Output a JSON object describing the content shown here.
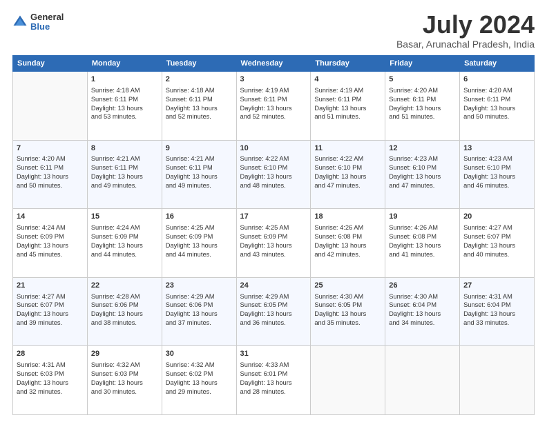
{
  "header": {
    "logo": {
      "line1": "General",
      "line2": "Blue"
    },
    "title": "July 2024",
    "subtitle": "Basar, Arunachal Pradesh, India"
  },
  "weekdays": [
    "Sunday",
    "Monday",
    "Tuesday",
    "Wednesday",
    "Thursday",
    "Friday",
    "Saturday"
  ],
  "weeks": [
    [
      {
        "day": "",
        "info": ""
      },
      {
        "day": "1",
        "info": "Sunrise: 4:18 AM\nSunset: 6:11 PM\nDaylight: 13 hours\nand 53 minutes."
      },
      {
        "day": "2",
        "info": "Sunrise: 4:18 AM\nSunset: 6:11 PM\nDaylight: 13 hours\nand 52 minutes."
      },
      {
        "day": "3",
        "info": "Sunrise: 4:19 AM\nSunset: 6:11 PM\nDaylight: 13 hours\nand 52 minutes."
      },
      {
        "day": "4",
        "info": "Sunrise: 4:19 AM\nSunset: 6:11 PM\nDaylight: 13 hours\nand 51 minutes."
      },
      {
        "day": "5",
        "info": "Sunrise: 4:20 AM\nSunset: 6:11 PM\nDaylight: 13 hours\nand 51 minutes."
      },
      {
        "day": "6",
        "info": "Sunrise: 4:20 AM\nSunset: 6:11 PM\nDaylight: 13 hours\nand 50 minutes."
      }
    ],
    [
      {
        "day": "7",
        "info": "Sunrise: 4:20 AM\nSunset: 6:11 PM\nDaylight: 13 hours\nand 50 minutes."
      },
      {
        "day": "8",
        "info": "Sunrise: 4:21 AM\nSunset: 6:11 PM\nDaylight: 13 hours\nand 49 minutes."
      },
      {
        "day": "9",
        "info": "Sunrise: 4:21 AM\nSunset: 6:11 PM\nDaylight: 13 hours\nand 49 minutes."
      },
      {
        "day": "10",
        "info": "Sunrise: 4:22 AM\nSunset: 6:10 PM\nDaylight: 13 hours\nand 48 minutes."
      },
      {
        "day": "11",
        "info": "Sunrise: 4:22 AM\nSunset: 6:10 PM\nDaylight: 13 hours\nand 47 minutes."
      },
      {
        "day": "12",
        "info": "Sunrise: 4:23 AM\nSunset: 6:10 PM\nDaylight: 13 hours\nand 47 minutes."
      },
      {
        "day": "13",
        "info": "Sunrise: 4:23 AM\nSunset: 6:10 PM\nDaylight: 13 hours\nand 46 minutes."
      }
    ],
    [
      {
        "day": "14",
        "info": "Sunrise: 4:24 AM\nSunset: 6:09 PM\nDaylight: 13 hours\nand 45 minutes."
      },
      {
        "day": "15",
        "info": "Sunrise: 4:24 AM\nSunset: 6:09 PM\nDaylight: 13 hours\nand 44 minutes."
      },
      {
        "day": "16",
        "info": "Sunrise: 4:25 AM\nSunset: 6:09 PM\nDaylight: 13 hours\nand 44 minutes."
      },
      {
        "day": "17",
        "info": "Sunrise: 4:25 AM\nSunset: 6:09 PM\nDaylight: 13 hours\nand 43 minutes."
      },
      {
        "day": "18",
        "info": "Sunrise: 4:26 AM\nSunset: 6:08 PM\nDaylight: 13 hours\nand 42 minutes."
      },
      {
        "day": "19",
        "info": "Sunrise: 4:26 AM\nSunset: 6:08 PM\nDaylight: 13 hours\nand 41 minutes."
      },
      {
        "day": "20",
        "info": "Sunrise: 4:27 AM\nSunset: 6:07 PM\nDaylight: 13 hours\nand 40 minutes."
      }
    ],
    [
      {
        "day": "21",
        "info": "Sunrise: 4:27 AM\nSunset: 6:07 PM\nDaylight: 13 hours\nand 39 minutes."
      },
      {
        "day": "22",
        "info": "Sunrise: 4:28 AM\nSunset: 6:06 PM\nDaylight: 13 hours\nand 38 minutes."
      },
      {
        "day": "23",
        "info": "Sunrise: 4:29 AM\nSunset: 6:06 PM\nDaylight: 13 hours\nand 37 minutes."
      },
      {
        "day": "24",
        "info": "Sunrise: 4:29 AM\nSunset: 6:05 PM\nDaylight: 13 hours\nand 36 minutes."
      },
      {
        "day": "25",
        "info": "Sunrise: 4:30 AM\nSunset: 6:05 PM\nDaylight: 13 hours\nand 35 minutes."
      },
      {
        "day": "26",
        "info": "Sunrise: 4:30 AM\nSunset: 6:04 PM\nDaylight: 13 hours\nand 34 minutes."
      },
      {
        "day": "27",
        "info": "Sunrise: 4:31 AM\nSunset: 6:04 PM\nDaylight: 13 hours\nand 33 minutes."
      }
    ],
    [
      {
        "day": "28",
        "info": "Sunrise: 4:31 AM\nSunset: 6:03 PM\nDaylight: 13 hours\nand 32 minutes."
      },
      {
        "day": "29",
        "info": "Sunrise: 4:32 AM\nSunset: 6:03 PM\nDaylight: 13 hours\nand 30 minutes."
      },
      {
        "day": "30",
        "info": "Sunrise: 4:32 AM\nSunset: 6:02 PM\nDaylight: 13 hours\nand 29 minutes."
      },
      {
        "day": "31",
        "info": "Sunrise: 4:33 AM\nSunset: 6:01 PM\nDaylight: 13 hours\nand 28 minutes."
      },
      {
        "day": "",
        "info": ""
      },
      {
        "day": "",
        "info": ""
      },
      {
        "day": "",
        "info": ""
      }
    ]
  ]
}
